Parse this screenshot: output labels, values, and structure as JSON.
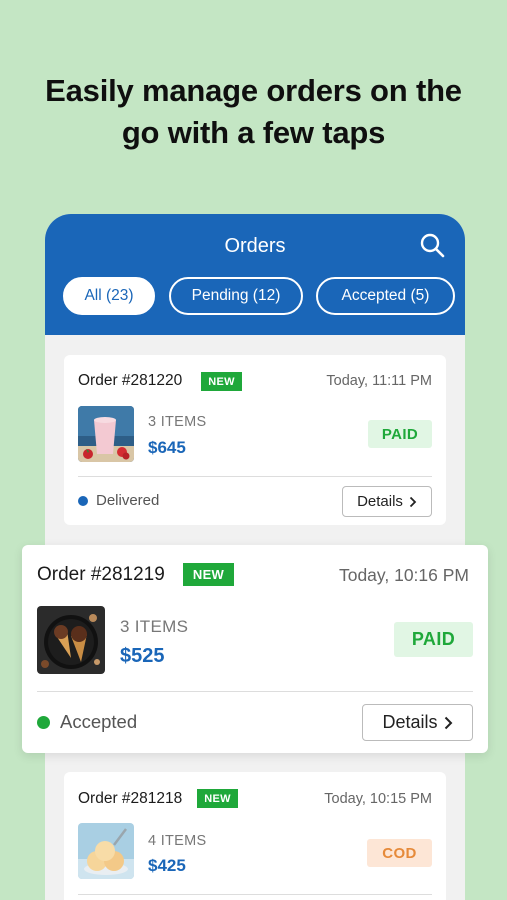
{
  "headline": {
    "line1": "Easily manage orders on the",
    "line2": "go with a few taps"
  },
  "header": {
    "title": "Orders",
    "search_icon": "search-icon",
    "accent": "#1a66b8"
  },
  "tabs": [
    {
      "label": "All (23)",
      "active": true
    },
    {
      "label": "Pending (12)",
      "active": false
    },
    {
      "label": "Accepted (5)",
      "active": false
    }
  ],
  "orders": [
    {
      "order_no": "Order #281220",
      "badge": "NEW",
      "time": "Today, 11:11 PM",
      "thumb": "strawberry-smoothie",
      "items": "3 ITEMS",
      "price": "$645",
      "payment": "PAID",
      "status": "Delivered",
      "status_color": "#1a66b8",
      "details": "Details"
    },
    {
      "order_no": "Order #281219",
      "badge": "NEW",
      "time": "Today, 10:16 PM",
      "thumb": "ice-cream-cones",
      "items": "3 ITEMS",
      "price": "$525",
      "payment": "PAID",
      "status": "Accepted",
      "status_color": "#1fa83a",
      "details": "Details"
    },
    {
      "order_no": "Order #281218",
      "badge": "NEW",
      "time": "Today, 10:15 PM",
      "thumb": "ice-cream-scoops",
      "items": "4 ITEMS",
      "price": "$425",
      "payment": "COD"
    }
  ],
  "colors": {
    "background": "#c4e6c4",
    "new_badge": "#1fa83a",
    "paid": "#1fa83a",
    "cod": "#e68a3a"
  }
}
